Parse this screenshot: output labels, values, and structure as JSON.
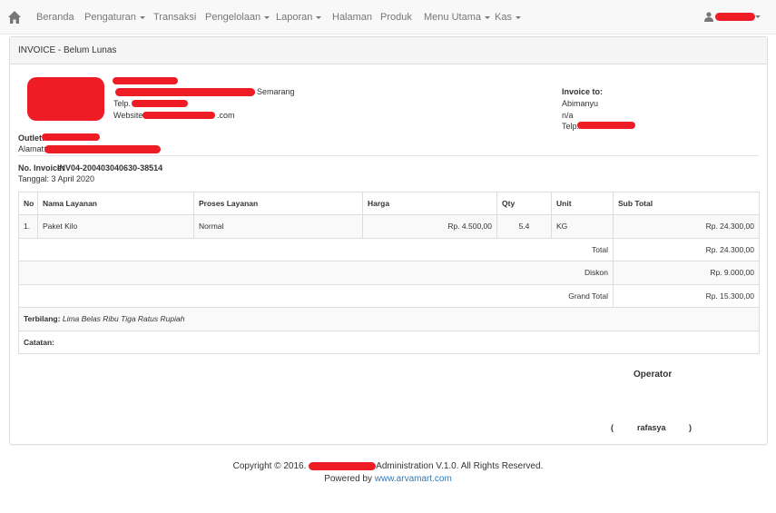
{
  "nav": {
    "home_icon": "home-icon",
    "items": [
      {
        "label": "Beranda"
      },
      {
        "label": "Pengaturan"
      },
      {
        "label": "Transaksi"
      },
      {
        "label": "Pengelolaan"
      },
      {
        "label": "Laporan"
      },
      {
        "label": "Halaman"
      },
      {
        "label": "Produk"
      },
      {
        "label": "Menu Utama"
      },
      {
        "label": "Kas"
      }
    ],
    "user_icon": "user-icon"
  },
  "panel": {
    "title": "INVOICE - Belum Lunas"
  },
  "company": {
    "address_suffix": "Semarang",
    "telp_label": "Telp.",
    "website_label": "Website",
    "website_suffix": ".com"
  },
  "outlet": {
    "outlet_label": "Outlet:",
    "alamat_label": "Alamat:"
  },
  "invoice_to": {
    "label": "Invoice to:",
    "name": "Abimanyu",
    "address": "n/a",
    "telp_label": "Telp."
  },
  "invoice": {
    "number_label": "No. Invoice:",
    "number": "INV04-200403040630-38514",
    "date": "Tanggal: 3 April 2020"
  },
  "table": {
    "headers": [
      "No",
      "Nama Layanan",
      "Proses Layanan",
      "Harga",
      "Qty",
      "Unit",
      "Sub Total"
    ],
    "rows": [
      {
        "no": "1.",
        "name": "Paket Kilo",
        "process": "Normal",
        "price": "Rp. 4.500,00",
        "qty": "5.4",
        "unit": "KG",
        "subtotal": "Rp. 24.300,00"
      }
    ],
    "total_label": "Total",
    "total": "Rp. 24.300,00",
    "diskon_label": "Diskon",
    "diskon": "Rp. 9.000,00",
    "grand_label": "Grand Total",
    "grand": "Rp. 15.300,00",
    "terbilang_label": "Terbilang:",
    "terbilang": "Lima Belas Ribu Tiga Ratus Rupiah",
    "catatan_label": "Catatan:"
  },
  "signature": {
    "title": "Operator",
    "open": "(",
    "name": "rafasya",
    "close": ")"
  },
  "footer": {
    "copyright_prefix": "Copyright © 2016.",
    "copyright_suffix": "Administration V.1.0. All Rights Reserved.",
    "powered_prefix": "Powered by",
    "powered_link": "www.arvamart.com"
  }
}
